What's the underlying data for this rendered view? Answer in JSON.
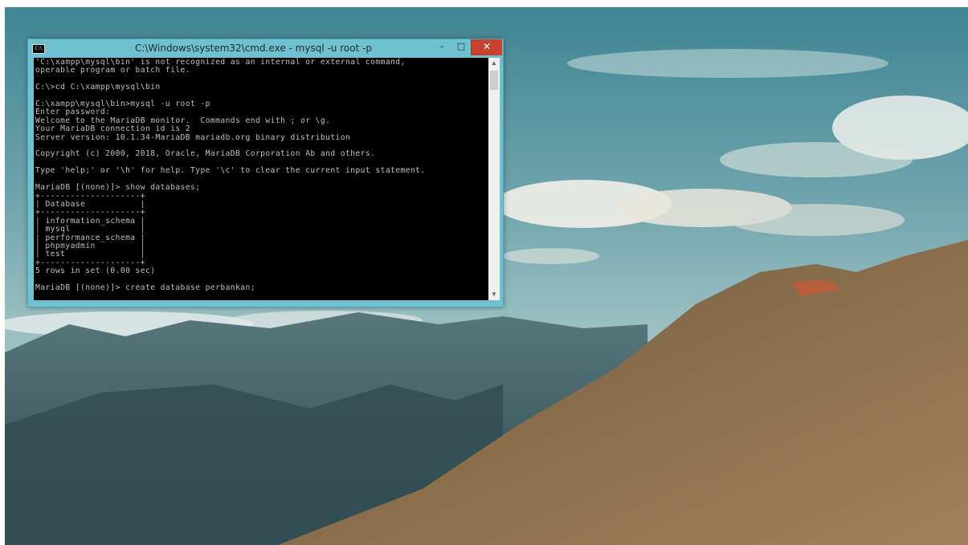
{
  "window": {
    "title": "C:\\Windows\\system32\\cmd.exe - mysql  -u root -p",
    "icon": "cmd-icon",
    "icon_text": "C:\\",
    "buttons": {
      "minimize": "–",
      "maximize": "□",
      "close": "✕"
    }
  },
  "console": {
    "lines": [
      "'C:\\xampp\\mysql\\bin' is not recognized as an internal or external command,",
      "operable program or batch file.",
      "",
      "C:\\>cd C:\\xampp\\mysql\\bin",
      "",
      "C:\\xampp\\mysql\\bin>mysql -u root -p",
      "Enter password:",
      "Welcome to the MariaDB monitor.  Commands end with ; or \\g.",
      "Your MariaDB connection id is 2",
      "Server version: 10.1.34-MariaDB mariadb.org binary distribution",
      "",
      "Copyright (c) 2000, 2018, Oracle, MariaDB Corporation Ab and others.",
      "",
      "Type 'help;' or '\\h' for help. Type '\\c' to clear the current input statement.",
      "",
      "MariaDB [(none)]> show databases;",
      "+--------------------+",
      "| Database           |",
      "+--------------------+",
      "| information_schema |",
      "| mysql              |",
      "| performance_schema |",
      "| phpmyadmin         |",
      "| test               |",
      "+--------------------+",
      "5 rows in set (0.00 sec)",
      "",
      "MariaDB [(none)]> create database perbankan;"
    ]
  },
  "scrollbar": {
    "up_arrow": "▲",
    "down_arrow": "▼"
  },
  "colors": {
    "titlebar": "#6fc1cf",
    "close_button": "#c7432f",
    "console_bg": "#000000",
    "console_text": "#c0c0c0"
  }
}
